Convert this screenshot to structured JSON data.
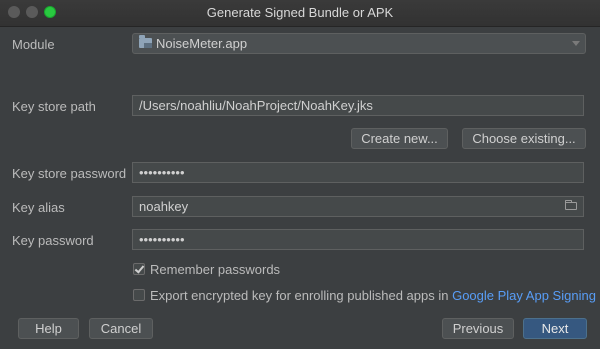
{
  "window": {
    "title": "Generate Signed Bundle or APK"
  },
  "module": {
    "label": "Module",
    "value": "NoiseMeter.app"
  },
  "key_store_path": {
    "label": "Key store path",
    "value": "/Users/noahliu/NoahProject/NoahKey.jks"
  },
  "buttons": {
    "create_new": "Create new...",
    "choose_existing": "Choose existing...",
    "help": "Help",
    "cancel": "Cancel",
    "previous": "Previous",
    "next": "Next"
  },
  "key_store_password": {
    "label": "Key store password",
    "value": "••••••••••"
  },
  "key_alias": {
    "label": "Key alias",
    "value": "noahkey"
  },
  "key_password": {
    "label": "Key password",
    "value": "••••••••••"
  },
  "remember_passwords": {
    "label": "Remember passwords",
    "checked": true
  },
  "export_key": {
    "label": "Export encrypted key for enrolling published apps in",
    "link": "Google Play App Signing",
    "checked": false
  },
  "colors": {
    "primary_button": "#365880",
    "link": "#589df6",
    "background": "#3c3f41"
  },
  "icons": {
    "module": "folder-module-icon",
    "browse": "folder-browse-icon",
    "dropdown": "chevron-down-icon"
  }
}
